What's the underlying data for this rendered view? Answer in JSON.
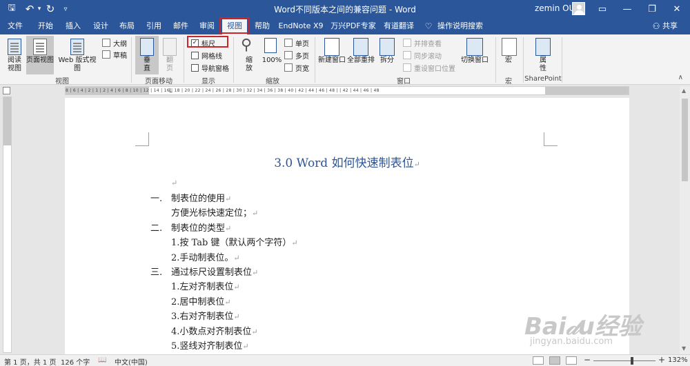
{
  "window": {
    "title": "Word不同版本之间的兼容问题 - Word",
    "user": "zemin OU",
    "controls": {
      "ribbon_display": "▭",
      "minimize": "—",
      "restore": "❐",
      "close": "✕"
    },
    "quick_access": {
      "save": "🖫",
      "undo": "↶",
      "undo_drop": "▾",
      "redo": "↻",
      "customize": "▿"
    }
  },
  "tabs": [
    {
      "id": "file",
      "label": "文件"
    },
    {
      "id": "home",
      "label": "开始"
    },
    {
      "id": "insert",
      "label": "插入"
    },
    {
      "id": "design",
      "label": "设计"
    },
    {
      "id": "layout",
      "label": "布局"
    },
    {
      "id": "references",
      "label": "引用"
    },
    {
      "id": "mailings",
      "label": "邮件"
    },
    {
      "id": "review",
      "label": "审阅"
    },
    {
      "id": "view",
      "label": "视图",
      "active": true
    },
    {
      "id": "help",
      "label": "帮助"
    },
    {
      "id": "endnote",
      "label": "EndNote X9"
    },
    {
      "id": "wanxing",
      "label": "万兴PDF专家"
    },
    {
      "id": "youdao",
      "label": "有道翻译"
    }
  ],
  "tellme": {
    "icon": "lightbulb-icon",
    "label": "操作说明搜索",
    "glyph": "♡"
  },
  "share": {
    "icon": "person-icon",
    "label": "共享",
    "glyph": "⚇"
  },
  "ribbon": {
    "views": {
      "label": "视图",
      "read_mode": "阅读\n视图",
      "print_layout": "页面视图",
      "web_layout": "Web 版式视图",
      "outline": "大纲",
      "draft": "草稿"
    },
    "page_movement": {
      "label": "页面移动",
      "vertical": "垂\n直",
      "side_to_side": "翻\n页"
    },
    "show": {
      "label": "显示",
      "ruler": {
        "label": "标尺",
        "checked": true,
        "mark": "✓"
      },
      "gridlines": {
        "label": "网格线",
        "checked": false
      },
      "nav_pane": {
        "label": "导航窗格",
        "checked": false
      }
    },
    "zoom": {
      "label": "缩放",
      "zoom": "缩\n放",
      "hundred": "100%",
      "one_page": "单页",
      "multi_page": "多页",
      "page_width": "页宽",
      "magnifier": "⚲"
    },
    "window": {
      "label": "窗口",
      "new_window": "新建窗口",
      "arrange_all": "全部重排",
      "split": "拆分",
      "side_by_side": "并排查看",
      "sync_scroll": "同步滚动",
      "reset_pos": "重设窗口位置",
      "switch_windows": "切换窗口"
    },
    "macros": {
      "label": "宏",
      "macros": "宏"
    },
    "sharepoint": {
      "label": "SharePoint",
      "properties": "属\n性"
    },
    "collapse": "∧"
  },
  "ruler": {
    "numbers": "8 | 6 | 4 | 2 | 1 | 2 | 4 | 6 | 8 | 10 | 12 | 14 | 16 | 18 | 20 | 22 | 24 | 26 | 28 | 30 | 32 | 34 | 36 | 38 | 40 | 42 | 44 | 46 | 48 |  | 42 | 44 | 46 | 48",
    "tab_marker": "L"
  },
  "document": {
    "heading": "3.0 Word 如何快速制表位",
    "pilcrow": "↵",
    "items": [
      {
        "num": "一.",
        "text": "制表位的使用"
      },
      {
        "sub": "方便光标快速定位；"
      },
      {
        "num": "二.",
        "text": "制表位的类型"
      },
      {
        "sub": "1.按 Tab 键（默认两个字符）"
      },
      {
        "sub": "2.手动制表位。"
      },
      {
        "num": "三.",
        "text": "通过标尺设置制表位"
      },
      {
        "sub": "1.左对齐制表位"
      },
      {
        "sub": "2.居中制表位"
      },
      {
        "sub": "3.右对齐制表位"
      },
      {
        "sub": "4.小数点对齐制表位"
      },
      {
        "sub": "5.竖线对齐制表位"
      }
    ]
  },
  "scroll": {
    "up": "▲",
    "down": "▼"
  },
  "status": {
    "pages": "第 1 页，共 1 页",
    "words": "126 个字",
    "proof_icon": "📖",
    "language": "中文(中国)",
    "zoom_minus": "−",
    "zoom_plus": "+",
    "zoom": "132%",
    "zoom_level_fraction": 0.62
  },
  "watermark": {
    "big": "Bai𝒹u经验",
    "small": "jingyan.baidu.com"
  }
}
